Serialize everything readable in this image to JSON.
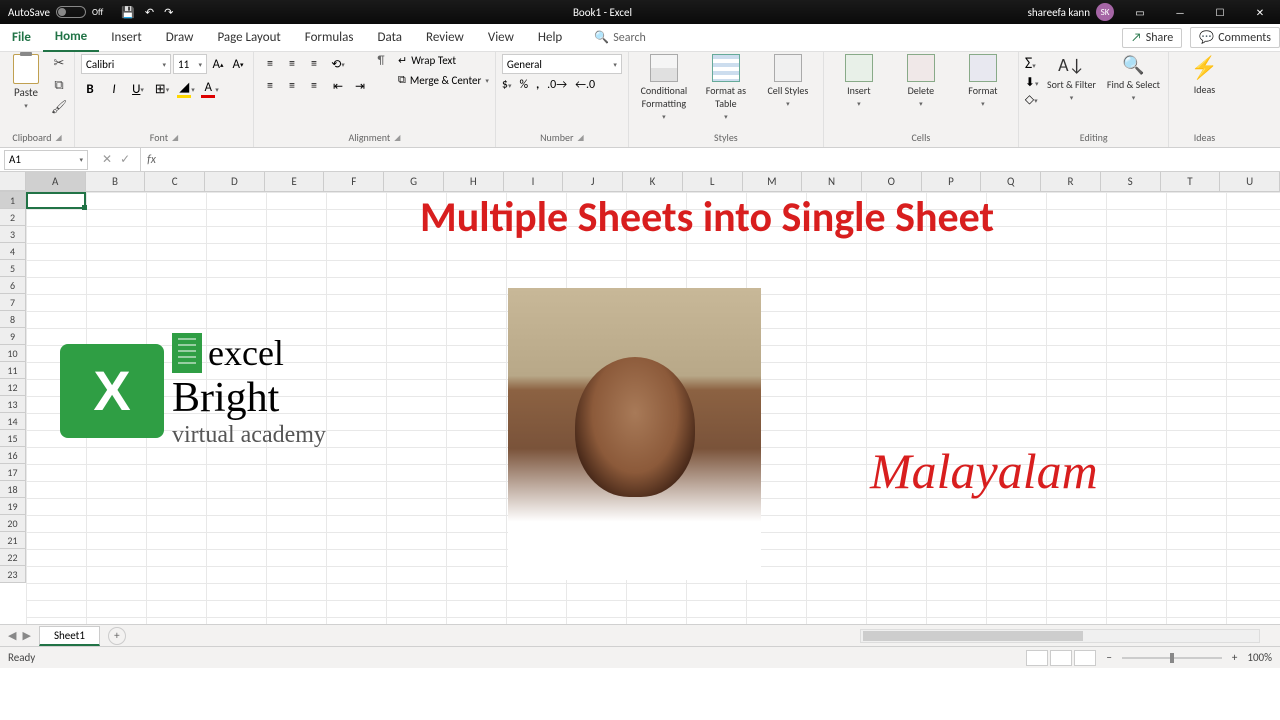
{
  "titlebar": {
    "autosave_label": "AutoSave",
    "autosave_state": "Off",
    "title": "Book1  -  Excel",
    "user_name": "shareefa kann",
    "user_initials": "SK"
  },
  "tabs": {
    "items": [
      "File",
      "Home",
      "Insert",
      "Draw",
      "Page Layout",
      "Formulas",
      "Data",
      "Review",
      "View",
      "Help"
    ],
    "active": "Home",
    "search_placeholder": "Search",
    "share": "Share",
    "comments": "Comments"
  },
  "ribbon": {
    "clipboard": {
      "label": "Clipboard",
      "paste": "Paste"
    },
    "font": {
      "label": "Font",
      "name": "Calibri",
      "size": "11"
    },
    "alignment": {
      "label": "Alignment",
      "wrap": "Wrap Text",
      "merge": "Merge & Center"
    },
    "number": {
      "label": "Number",
      "format": "General"
    },
    "styles": {
      "label": "Styles",
      "conditional": "Conditional Formatting",
      "format_table": "Format as Table",
      "cell_styles": "Cell Styles"
    },
    "cells": {
      "label": "Cells",
      "insert": "Insert",
      "delete": "Delete",
      "format": "Format"
    },
    "editing": {
      "label": "Editing",
      "sort": "Sort & Filter",
      "find": "Find & Select"
    },
    "ideas": {
      "label": "Ideas",
      "ideas": "Ideas"
    }
  },
  "formula_bar": {
    "name_box": "A1"
  },
  "grid": {
    "columns": [
      "A",
      "B",
      "C",
      "D",
      "E",
      "F",
      "G",
      "H",
      "I",
      "J",
      "K",
      "L",
      "M",
      "N",
      "O",
      "P",
      "Q",
      "R",
      "S",
      "T",
      "U"
    ],
    "rows": [
      1,
      2,
      3,
      4,
      5,
      6,
      7,
      8,
      9,
      10,
      11,
      12,
      13,
      14,
      15,
      16,
      17,
      18,
      19,
      20,
      21,
      22,
      23
    ],
    "selected_cell": "A1"
  },
  "overlays": {
    "title_text": "Multiple Sheets into Single Sheet",
    "language_text": "Malayalam",
    "logo": {
      "excel": "excel",
      "bright": "Bright",
      "va": "virtual academy"
    }
  },
  "sheet_tabs": {
    "active": "Sheet1"
  },
  "statusbar": {
    "status": "Ready",
    "zoom": "100%"
  }
}
